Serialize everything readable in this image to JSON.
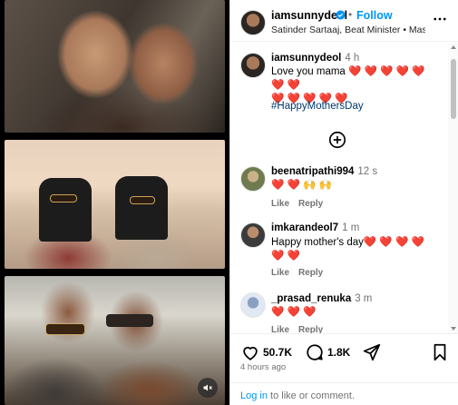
{
  "media": {
    "mute_icon": "speaker-muted-icon"
  },
  "header": {
    "username": "iamsunnydeol",
    "dot": "•",
    "follow_label": "Follow",
    "audio": "Satinder Sartaaj, Beat Minister • Masoom S...",
    "more_icon": "more-horizontal-icon"
  },
  "caption": {
    "username": "iamsunnydeol",
    "time": "4 h",
    "text": "Love you mama",
    "hearts_line1": "❤️ ❤️ ❤️ ❤️ ❤️ ❤️ ❤️",
    "hearts_line2": "❤️ ❤️ ❤️ ❤️ ❤️",
    "hashtag": "#HappyMothersDay"
  },
  "comments": [
    {
      "username": "beenatripathi994",
      "time": "12 s",
      "text": "❤️ ❤️ 🙌 🙌",
      "like": "Like",
      "reply": "Reply"
    },
    {
      "username": "imkarandeol7",
      "time": "1 m",
      "text": "Happy mother's day❤️ ❤️ ❤️ ❤️ ❤️ ❤️",
      "like": "Like",
      "reply": "Reply"
    },
    {
      "username": "_prasad_renuka",
      "time": "3 m",
      "text": "❤️ ❤️ ❤️",
      "like": "Like",
      "reply": "Reply"
    }
  ],
  "actions": {
    "likes": "50.7K",
    "comments": "1.8K",
    "time_ago": "4 hours ago",
    "login_link": "Log in",
    "login_rest": " to like or comment."
  },
  "colors": {
    "accent": "#0095f6",
    "heart": "#ed4956",
    "muted": "#737373"
  }
}
